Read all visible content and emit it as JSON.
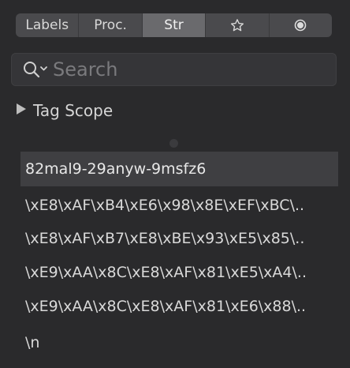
{
  "tabs": [
    {
      "label": "Labels",
      "active": false
    },
    {
      "label": "Proc.",
      "active": false
    },
    {
      "label": "Str",
      "active": true
    },
    {
      "icon": "star-icon",
      "active": false
    },
    {
      "icon": "record-icon",
      "active": false
    }
  ],
  "search": {
    "placeholder": "Search",
    "value": ""
  },
  "scope": {
    "label": "Tag Scope"
  },
  "strings": [
    {
      "text": "82mal9-29anyw-9msfz6",
      "selected": true
    },
    {
      "text": "\\xE8\\xAF\\xB4\\xE6\\x98\\x8E\\xEF\\xBC\\..",
      "selected": false
    },
    {
      "text": "\\xE8\\xAF\\xB7\\xE8\\xBE\\x93\\xE5\\x85\\..",
      "selected": false
    },
    {
      "text": "\\xE9\\xAA\\x8C\\xE8\\xAF\\x81\\xE5\\xA4\\..",
      "selected": false
    },
    {
      "text": "\\xE9\\xAA\\x8C\\xE8\\xAF\\x81\\xE6\\x88\\..",
      "selected": false
    },
    {
      "text": "\\n",
      "selected": false
    }
  ],
  "colors": {
    "background": "#2a2a2c",
    "selected_row": "#3f3f42",
    "active_tab": "#6a6a6d"
  }
}
